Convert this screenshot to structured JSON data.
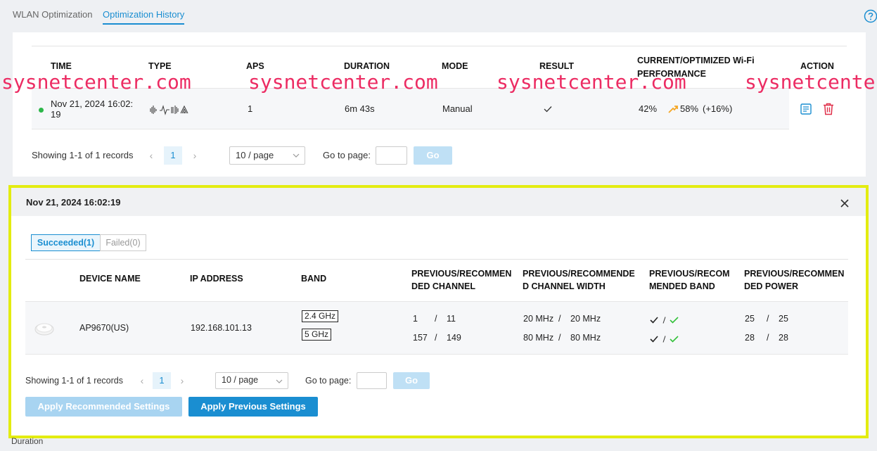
{
  "tabs": [
    {
      "label": "WLAN Optimization"
    },
    {
      "label": "Optimization History"
    }
  ],
  "history_table": {
    "headers": {
      "time": "TIME",
      "type": "TYPE",
      "aps": "APS",
      "duration": "DURATION",
      "mode": "MODE",
      "result": "RESULT",
      "performance_line1": "CURRENT/OPTIMIZED Wi-Fi",
      "performance_line2": "PERFORMANCE",
      "action": "ACTION"
    },
    "row": {
      "time_line1": "Nov 21, 2024 16:02:",
      "time_line2": "19",
      "aps": "1",
      "duration": "6m 43s",
      "mode": "Manual",
      "perf_before": "42%",
      "perf_after": "58%",
      "perf_delta": "(+16%)"
    },
    "pagination": {
      "summary": "Showing 1-1 of 1 records",
      "page": "1",
      "per_page": "10 / page",
      "goto_label": "Go to page:",
      "go": "Go"
    }
  },
  "detail": {
    "title": "Nov 21, 2024 16:02:19",
    "segments": {
      "succeeded": "Succeeded(1)",
      "failed": "Failed(0)"
    },
    "headers": {
      "device": "DEVICE NAME",
      "ip": "IP ADDRESS",
      "band": "BAND",
      "channel_1": "PREVIOUS/RECOMMEN",
      "channel_2": "DED CHANNEL",
      "width_1": "PREVIOUS/RECOMMENDE",
      "width_2": "D CHANNEL WIDTH",
      "band2_1": "PREVIOUS/RECOM",
      "band2_2": "MENDED BAND",
      "power_1": "PREVIOUS/RECOMMEN",
      "power_2": "DED POWER"
    },
    "row": {
      "device": "AP9670(US)",
      "ip": "192.168.101.13",
      "bands": [
        "2.4 GHz",
        "5 GHz"
      ],
      "channel_prev": [
        "1",
        "157"
      ],
      "channel_rec": [
        "11",
        "149"
      ],
      "width_prev": [
        "20 MHz",
        "80 MHz"
      ],
      "width_rec": [
        "20 MHz",
        "80 MHz"
      ],
      "power_prev": [
        "25",
        "28"
      ],
      "power_rec": [
        "25",
        "28"
      ],
      "sep": "/"
    },
    "pagination": {
      "summary": "Showing 1-1 of 1 records",
      "page": "1",
      "per_page": "10 / page",
      "goto_label": "Go to page:",
      "go": "Go"
    },
    "buttons": {
      "apply_recommended": "Apply Recommended Settings",
      "apply_previous": "Apply Previous Settings"
    }
  },
  "watermark": "sysnetcenter.com",
  "watermark_clipped": "sysnetcenter",
  "bottom_fragment": "Duration",
  "colors": {
    "accent": "#1a8ed1",
    "success": "#33c13a",
    "warn": "#f5a623",
    "danger": "#e0304a",
    "highlight_border": "#e3ec10"
  }
}
